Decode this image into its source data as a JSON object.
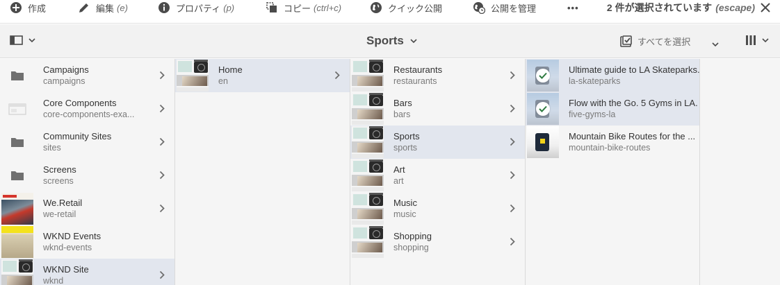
{
  "actionbar": {
    "create": {
      "label": "作成",
      "icon": "add-circle-icon"
    },
    "edit": {
      "label": "編集",
      "shortcut": "(e)",
      "icon": "pencil-icon"
    },
    "properties": {
      "label": "プロパティ",
      "shortcut": "(p)",
      "icon": "info-icon"
    },
    "copy": {
      "label": "コピー",
      "shortcut": "(ctrl+c)",
      "icon": "copy-icon"
    },
    "quick_publish": {
      "label": "クイック公開",
      "icon": "globe-icon"
    },
    "manage_publication": {
      "label": "公開を管理",
      "icon": "globe-clock-icon"
    },
    "more": {
      "label": "•••"
    },
    "selection": {
      "label": "2 件が選択されています",
      "shortcut": "(escape)"
    }
  },
  "titlebar": {
    "title": "Sports",
    "select_all": "すべてを選択"
  },
  "colors": {
    "active_row": "#e2e6ee",
    "column_bg": "#f5f5f5",
    "text": "#4b4b4b"
  },
  "columns": [
    {
      "items": [
        {
          "title": "Campaigns",
          "name": "campaigns",
          "thumb": "folder",
          "active": false
        },
        {
          "title": "Core Components",
          "name": "core-components-exa...",
          "thumb": "component",
          "active": false
        },
        {
          "title": "Community Sites",
          "name": "sites",
          "thumb": "folder",
          "active": false
        },
        {
          "title": "Screens",
          "name": "screens",
          "thumb": "folder",
          "active": false
        },
        {
          "title": "We.Retail",
          "name": "we-retail",
          "thumb": "weretail",
          "active": false
        },
        {
          "title": "WKND Events",
          "name": "wknd-events",
          "thumb": "wknde",
          "active": false
        },
        {
          "title": "WKND Site",
          "name": "wknd",
          "thumb": "page",
          "active": true
        }
      ]
    },
    {
      "items": [
        {
          "title": "Home",
          "name": "en",
          "thumb": "page",
          "active": true
        }
      ]
    },
    {
      "items": [
        {
          "title": "Restaurants",
          "name": "restaurants",
          "thumb": "page",
          "active": false
        },
        {
          "title": "Bars",
          "name": "bars",
          "thumb": "page",
          "active": false
        },
        {
          "title": "Sports",
          "name": "sports",
          "thumb": "page",
          "active": true
        },
        {
          "title": "Art",
          "name": "art",
          "thumb": "page",
          "active": false
        },
        {
          "title": "Music",
          "name": "music",
          "thumb": "page",
          "active": false
        },
        {
          "title": "Shopping",
          "name": "shopping",
          "thumb": "page",
          "active": false
        }
      ]
    },
    {
      "items": [
        {
          "title": "Ultimate guide to LA Skateparks.",
          "name": "la-skateparks",
          "thumb": "article",
          "selected": true
        },
        {
          "title": "Flow with the Go. 5 Gyms in LA.",
          "name": "five-gyms-la",
          "thumb": "article",
          "selected": true
        },
        {
          "title": "Mountain Bike Routes for the ...",
          "name": "mountain-bike-routes",
          "thumb": "article",
          "selected": false
        }
      ]
    }
  ]
}
